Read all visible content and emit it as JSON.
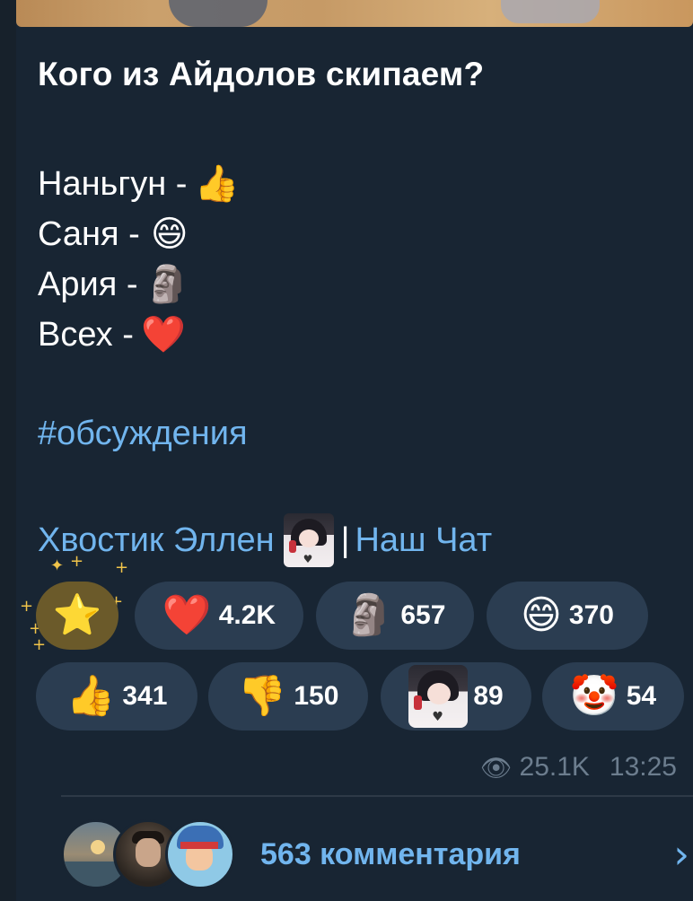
{
  "post": {
    "title": "Кого из Айдолов скипаем?",
    "options": [
      {
        "label": "Наньгун -",
        "emoji": "👍"
      },
      {
        "label": "Саня -",
        "emoji": "😄"
      },
      {
        "label": "Ария -",
        "emoji": "🗿"
      },
      {
        "label": "Всех -",
        "emoji": "❤️"
      }
    ],
    "hashtag": "#обсуждения",
    "channel_link": "Хвостик Эллен",
    "separator": "|",
    "chat_link": "Наш Чат"
  },
  "reactions": [
    {
      "icon": "star-icon",
      "emoji": "⭐",
      "count": ""
    },
    {
      "icon": "heart-icon",
      "emoji": "❤️",
      "count": "4.2K"
    },
    {
      "icon": "moai-icon",
      "emoji": "🗿",
      "count": "657"
    },
    {
      "icon": "grin-icon",
      "emoji": "😄",
      "count": "370"
    },
    {
      "icon": "thumbs-up-icon",
      "emoji": "👍",
      "count": "341"
    },
    {
      "icon": "thumbs-down-icon",
      "emoji": "👎",
      "count": "150"
    },
    {
      "icon": "custom-avatar-icon",
      "emoji": "",
      "count": "89"
    },
    {
      "icon": "clown-icon",
      "emoji": "🤡",
      "count": "54"
    }
  ],
  "meta": {
    "views": "25.1K",
    "time": "13:25"
  },
  "comments": {
    "label": "563 комментария"
  },
  "colors": {
    "background": "#17212b",
    "bubble": "#182533",
    "link": "#71b5ee",
    "pill": "#2b3d51",
    "meta": "#6c7d8e"
  }
}
